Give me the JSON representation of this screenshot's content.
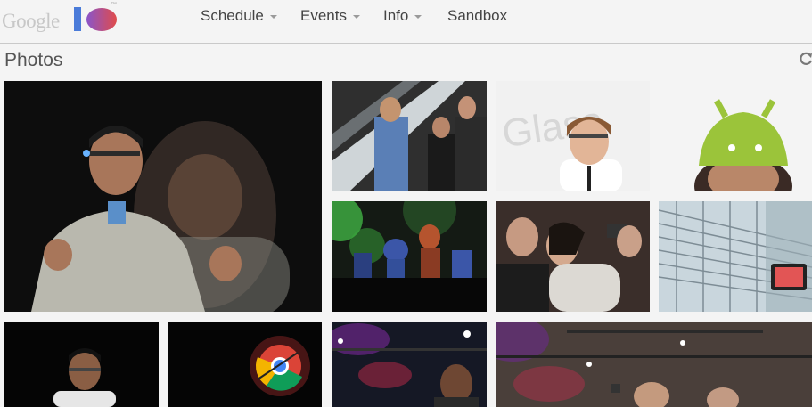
{
  "header": {
    "logo_text": "Google",
    "nav": [
      {
        "label": "Schedule",
        "has_dropdown": true
      },
      {
        "label": "Events",
        "has_dropdown": true
      },
      {
        "label": "Info",
        "has_dropdown": true
      },
      {
        "label": "Sandbox",
        "has_dropdown": false
      }
    ]
  },
  "main": {
    "section_title": "Photos"
  },
  "photos": [
    {
      "name": "speaker-with-glass"
    },
    {
      "name": "escalator-attendees"
    },
    {
      "name": "glass-woman-smiling"
    },
    {
      "name": "android-hat"
    },
    {
      "name": "android-robot-toys"
    },
    {
      "name": "crowd-photographer"
    },
    {
      "name": "glass-building-screen"
    },
    {
      "name": "speaker-keynote"
    },
    {
      "name": "chrome-logo"
    },
    {
      "name": "audience-stage-lights"
    },
    {
      "name": "conference-hall"
    }
  ],
  "colors": {
    "accent_blue": "#4a7bd9",
    "accent_red": "#e04b4b",
    "nav_text": "#444444",
    "header_bg": "#f4f4f4"
  }
}
